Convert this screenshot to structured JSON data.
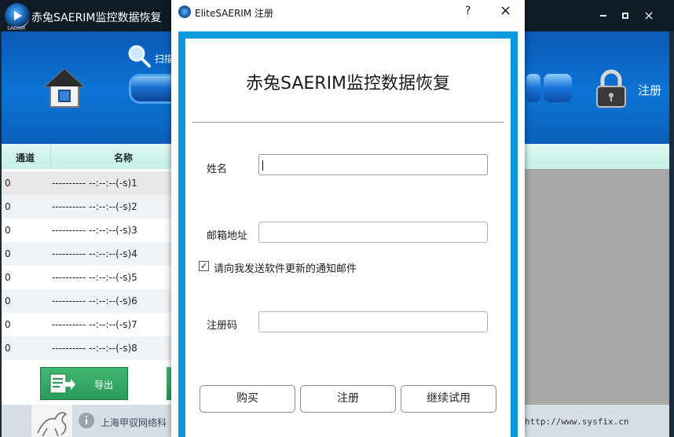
{
  "app": {
    "title": "赤兔SAERIM监控数据恢复",
    "logo_text": "SAERIM",
    "window_controls": {
      "close": "×"
    },
    "toolbar": {
      "scan_label": "扫描",
      "register_label": "注册"
    },
    "grid": {
      "columns": [
        "通道",
        "名称"
      ],
      "rows": [
        {
          "channel": "0",
          "name": "---------- --:--:--(-s)1"
        },
        {
          "channel": "0",
          "name": "---------- --:--:--(-s)2"
        },
        {
          "channel": "0",
          "name": "---------- --:--:--(-s)3"
        },
        {
          "channel": "0",
          "name": "---------- --:--:--(-s)4"
        },
        {
          "channel": "0",
          "name": "---------- --:--:--(-s)5"
        },
        {
          "channel": "0",
          "name": "---------- --:--:--(-s)6"
        },
        {
          "channel": "0",
          "name": "---------- --:--:--(-s)7"
        },
        {
          "channel": "0",
          "name": "---------- --:--:--(-s)8"
        }
      ]
    },
    "export_label": "导出",
    "footer": {
      "company": "上海甲驭网络科",
      "url": "http://www.sysfix.cn"
    }
  },
  "dialog": {
    "title": "EliteSAERIM 注册",
    "help": "?",
    "close": "×",
    "heading": "赤兔SAERIM监控数据恢复",
    "fields": {
      "name_label": "姓名",
      "name_value": "",
      "email_label": "邮箱地址",
      "email_value": "",
      "code_label": "注册码",
      "code_value": ""
    },
    "notify": {
      "checked": true,
      "check_mark": "✓",
      "label": "请向我发送软件更新的通知邮件"
    },
    "buttons": {
      "buy": "购买",
      "register": "注册",
      "trial": "继续试用"
    }
  },
  "colors": {
    "toolbar_blue": "#0c74d6",
    "dialog_frame": "#0b98dc",
    "header_mint": "#c4efe8",
    "export_green": "#2a9a58"
  }
}
